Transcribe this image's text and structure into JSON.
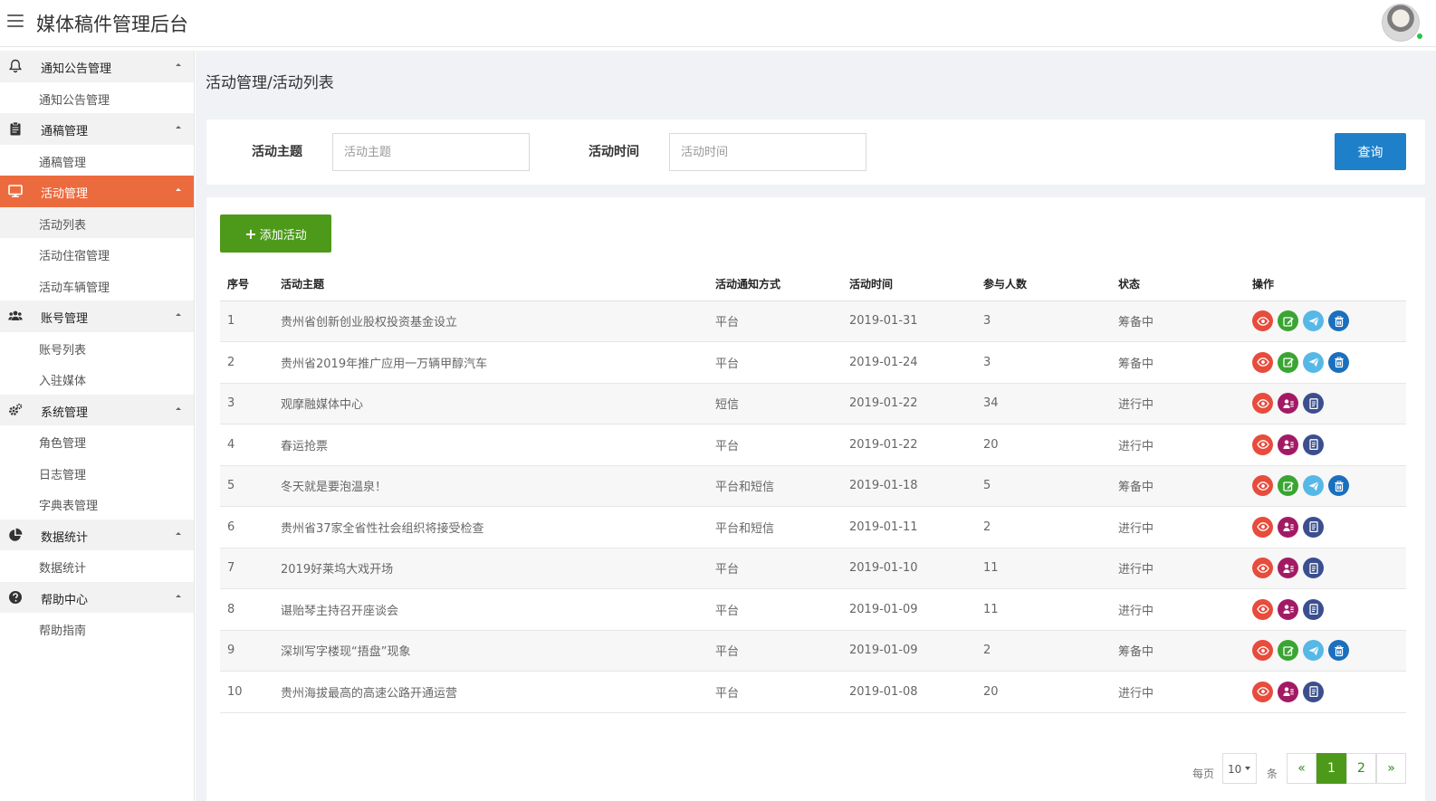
{
  "header": {
    "title": "媒体稿件管理后台"
  },
  "sidebar": {
    "groups": [
      {
        "label": "通知公告管理",
        "icon": "bell-icon",
        "items": [
          "通知公告管理"
        ]
      },
      {
        "label": "通稿管理",
        "icon": "clipboard-icon",
        "items": [
          "通稿管理"
        ]
      },
      {
        "label": "活动管理",
        "icon": "monitor-icon",
        "items": [
          "活动列表",
          "活动住宿管理",
          "活动车辆管理"
        ]
      },
      {
        "label": "账号管理",
        "icon": "users-icon",
        "items": [
          "账号列表",
          "入驻媒体"
        ]
      },
      {
        "label": "系统管理",
        "icon": "gears-icon",
        "items": [
          "角色管理",
          "日志管理",
          "字典表管理"
        ]
      },
      {
        "label": "数据统计",
        "icon": "pie-chart-icon",
        "items": [
          "数据统计"
        ]
      },
      {
        "label": "帮助中心",
        "icon": "question-icon",
        "items": [
          "帮助指南"
        ]
      }
    ]
  },
  "breadcrumb": "活动管理/活动列表",
  "search": {
    "topic_label": "活动主题",
    "topic_placeholder": "活动主题",
    "time_label": "活动时间",
    "time_placeholder": "活动时间",
    "query_label": "查询"
  },
  "toolbar": {
    "add_label": "添加活动"
  },
  "table": {
    "headers": [
      "序号",
      "活动主题",
      "活动通知方式",
      "活动时间",
      "参与人数",
      "状态",
      "操作"
    ],
    "rows": [
      [
        "1",
        "贵州省创新创业股权投资基金设立",
        "平台",
        "2019-01-31",
        "3",
        "筹备中"
      ],
      [
        "2",
        "贵州省2019年推广应用一万辆甲醇汽车",
        "平台",
        "2019-01-24",
        "3",
        "筹备中"
      ],
      [
        "3",
        "观摩融媒体中心",
        "短信",
        "2019-01-22",
        "34",
        "进行中"
      ],
      [
        "4",
        "春运抢票",
        "平台",
        "2019-01-22",
        "20",
        "进行中"
      ],
      [
        "5",
        "冬天就是要泡温泉！",
        "平台和短信",
        "2019-01-18",
        "5",
        "筹备中"
      ],
      [
        "6",
        "贵州省37家全省性社会组织将接受检查",
        "平台和短信",
        "2019-01-11",
        "2",
        "进行中"
      ],
      [
        "7",
        "2019好莱坞大戏开场",
        "平台",
        "2019-01-10",
        "11",
        "进行中"
      ],
      [
        "8",
        "谌贻琴主持召开座谈会",
        "平台",
        "2019-01-09",
        "11",
        "进行中"
      ],
      [
        "9",
        "深圳写字楼现“捂盘”现象",
        "平台",
        "2019-01-09",
        "2",
        "筹备中"
      ],
      [
        "10",
        "贵州海拔最高的高速公路开通运营",
        "平台",
        "2019-01-08",
        "20",
        "进行中"
      ]
    ]
  },
  "pagination": {
    "per_page_label": "每页",
    "per_page_value": "10",
    "unit_label": "条",
    "prev": "«",
    "pages": [
      "1",
      "2"
    ],
    "next": "»"
  }
}
